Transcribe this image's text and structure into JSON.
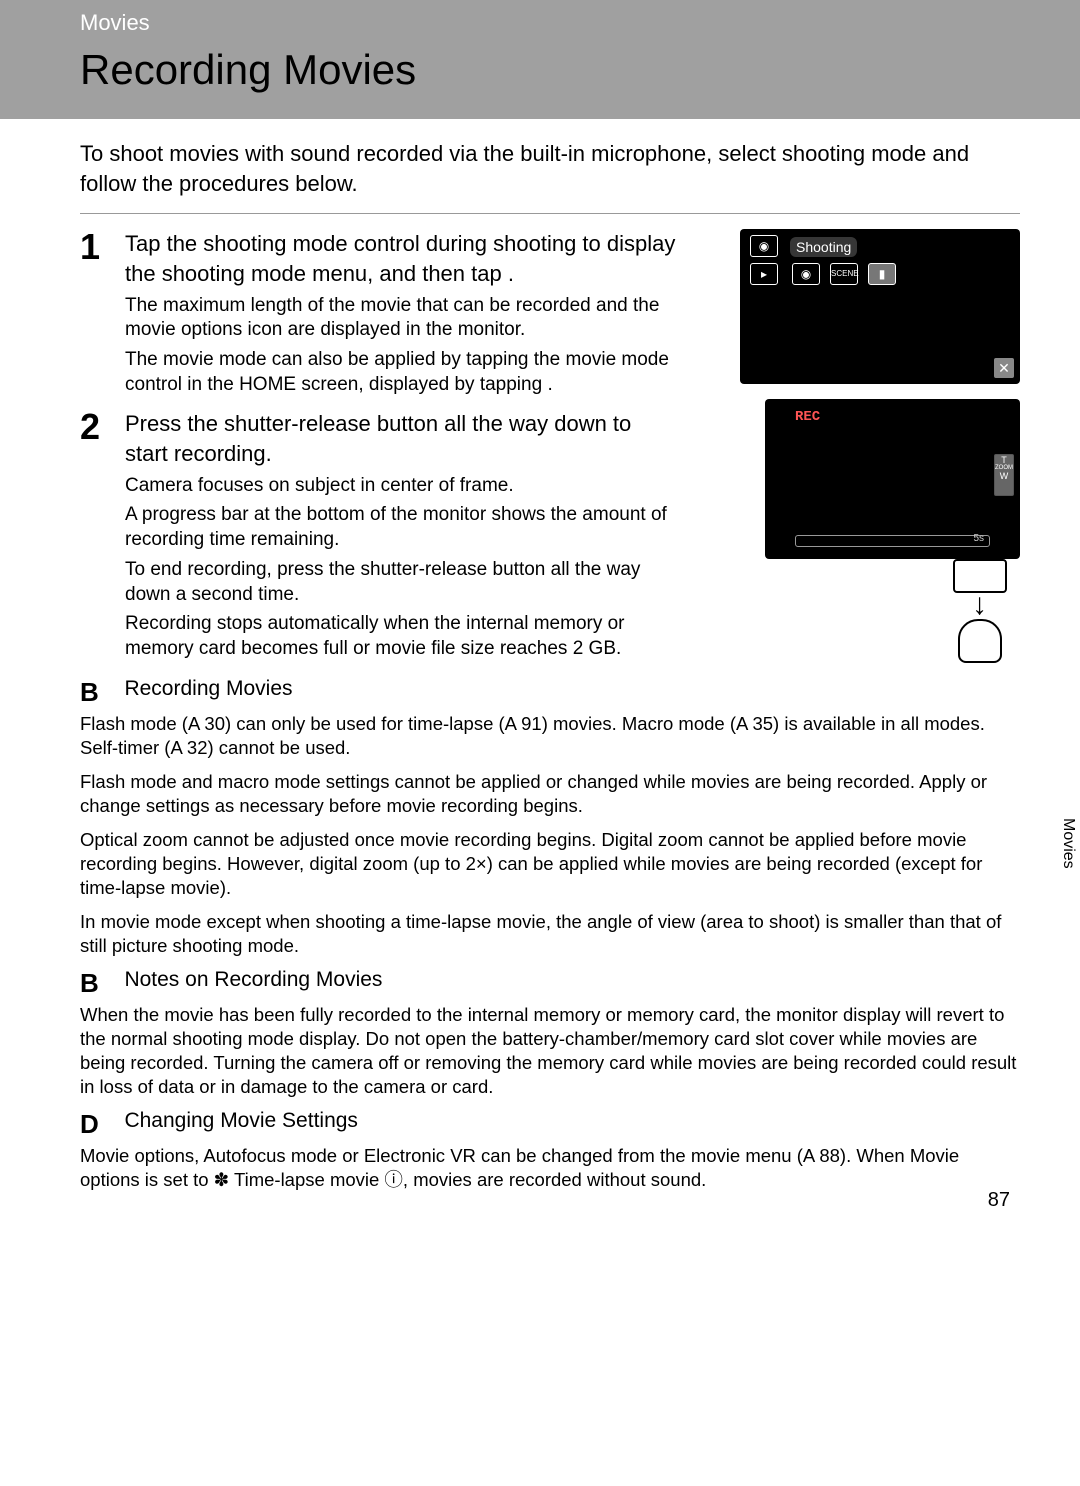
{
  "header": {
    "breadcrumb": "Movies",
    "title": "Recording Movies"
  },
  "intro": "To shoot movies with sound recorded via the built-in microphone, select shooting mode and follow the procedures below.",
  "steps": [
    {
      "num": "1",
      "heading": "Tap the shooting mode control during shooting to display the shooting mode menu, and then tap   .",
      "details": [
        "The maximum length of the movie that can be recorded and the movie options icon are displayed in the monitor.",
        "The movie mode can also be applied by tapping the movie mode control in the HOME screen, displayed by tapping  ."
      ]
    },
    {
      "num": "2",
      "heading": "Press the shutter-release button all the way down to start recording.",
      "details": [
        "Camera focuses on subject in center of frame.",
        "A progress bar at the bottom of the monitor shows the amount of recording time remaining.",
        "To end recording, press the shutter-release button all the way down a second time.",
        "Recording stops automatically when the internal memory or memory card becomes full or movie file size reaches 2 GB."
      ]
    }
  ],
  "fig1": {
    "label": "Shooting",
    "close": "✕"
  },
  "fig2": {
    "rec": "REC",
    "time": "5s",
    "zoom_t": "T",
    "zoom_w": "W"
  },
  "notes": [
    {
      "letter": "B",
      "title": "Recording Movies",
      "paras": [
        "Flash mode (A 30) can only be used for time-lapse (A 91) movies. Macro mode (A 35) is available in all modes. Self-timer (A 32) cannot be used.",
        "Flash mode and macro mode settings cannot be applied or changed while movies are being recorded. Apply or change settings as necessary before movie recording begins.",
        "Optical zoom cannot be adjusted once movie recording begins. Digital zoom cannot be applied before movie recording begins. However, digital zoom (up to 2×) can be applied while movies are being recorded (except for time-lapse movie).",
        "In movie mode except when shooting a time-lapse movie, the angle of view (area to shoot) is smaller than that of still picture shooting mode."
      ]
    },
    {
      "letter": "B",
      "title": "Notes on Recording Movies",
      "paras": [
        "When the movie has been fully recorded to the internal memory or memory card, the monitor display will revert to the normal shooting mode display. Do not open the battery-chamber/memory card slot cover while movies are being recorded. Turning the camera off or removing the memory card while movies are being recorded could result in loss of data or in damage to the camera or card."
      ]
    },
    {
      "letter": "D",
      "title": "Changing Movie Settings",
      "paras": [
        "Movie options, Autofocus mode or Electronic VR can be changed from the movie menu (A 88). When Movie options is set to ✽ Time-lapse movie ⓘ, movies are recorded without sound."
      ]
    }
  ],
  "side_tab": "Movies",
  "page_num": "87"
}
